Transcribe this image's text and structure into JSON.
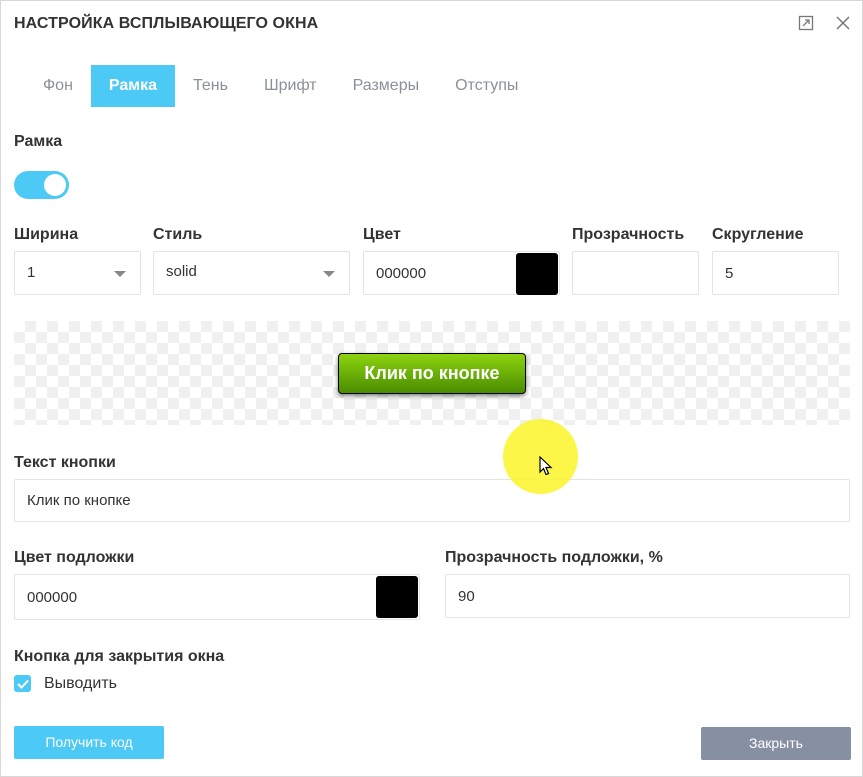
{
  "dialog": {
    "title": "НАСТРОЙКА ВСПЛЫВАЮЩЕГО ОКНА",
    "maximize_icon": "maximize-icon",
    "close_icon": "close-icon"
  },
  "tabs": [
    {
      "label": "Фон",
      "active": false
    },
    {
      "label": "Рамка",
      "active": true
    },
    {
      "label": "Тень",
      "active": false
    },
    {
      "label": "Шрифт",
      "active": false
    },
    {
      "label": "Размеры",
      "active": false
    },
    {
      "label": "Отступы",
      "active": false
    }
  ],
  "border": {
    "section_label": "Рамка",
    "enabled": true,
    "width": {
      "label": "Ширина",
      "value": "1"
    },
    "style": {
      "label": "Стиль",
      "value": "solid"
    },
    "color": {
      "label": "Цвет",
      "value": "000000",
      "swatch": "#000000"
    },
    "opacity": {
      "label": "Прозрачность",
      "value": ""
    },
    "radius": {
      "label": "Скругление",
      "value": "5"
    }
  },
  "preview": {
    "button_text": "Клик по кнопке"
  },
  "button_text": {
    "label": "Текст кнопки",
    "value": "Клик по кнопке"
  },
  "overlay": {
    "color_label": "Цвет подложки",
    "color_value": "000000",
    "swatch": "#000000",
    "opacity_label": "Прозрачность подложки, %",
    "opacity_value": "90"
  },
  "close_button": {
    "label": "Кнопка для закрытия окна",
    "checkbox_label": "Выводить",
    "checked": true
  },
  "footer": {
    "get_code": "Получить код",
    "close": "Закрыть"
  },
  "colors": {
    "accent": "#4cc9f5",
    "secondary": "#8690a2",
    "demo_button_top": "#8dd30f",
    "demo_button_bottom": "#4a8c00"
  }
}
